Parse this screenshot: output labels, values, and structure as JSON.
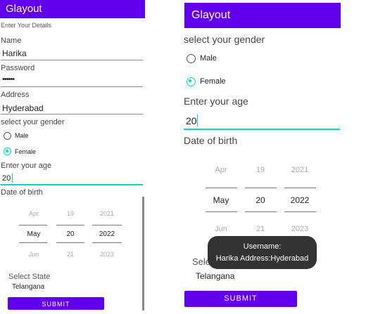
{
  "left": {
    "title": "Glayout",
    "subtitle": "Enter Your Details",
    "name_label": "Name",
    "name_value": "Harika",
    "password_label": "Password",
    "password_value": "••••••",
    "address_label": "Address",
    "address_value": "Hyderabad",
    "gender_label": "select your gender",
    "gender_options": [
      "Male",
      "Female"
    ],
    "age_label": "Enter your age",
    "age_value": "20",
    "dob_label": "Date of birth",
    "dob": {
      "prev": [
        "Apr",
        "19",
        "2021"
      ],
      "current": [
        "May",
        "20",
        "2022"
      ],
      "next": [
        "Jun",
        "21",
        "2023"
      ]
    },
    "state_label": "Select State",
    "state_value": "Telangana",
    "submit": "SUBMIT"
  },
  "right": {
    "title": "Glayout",
    "gender_label": "select your gender",
    "gender_options": [
      "Male",
      "Female"
    ],
    "age_label": "Enter your age",
    "age_value": "20",
    "dob_label": "Date of birth",
    "dob": {
      "prev": [
        "Apr",
        "19",
        "2021"
      ],
      "current": [
        "May",
        "20",
        "2022"
      ],
      "next": [
        "Jun",
        "21",
        "2023"
      ]
    },
    "state_label_partial": "Sele",
    "state_value": "Telangana",
    "submit": "SUBMIT",
    "toast_line1": "Username:",
    "toast_line2": "Harika Address:Hyderabad"
  }
}
